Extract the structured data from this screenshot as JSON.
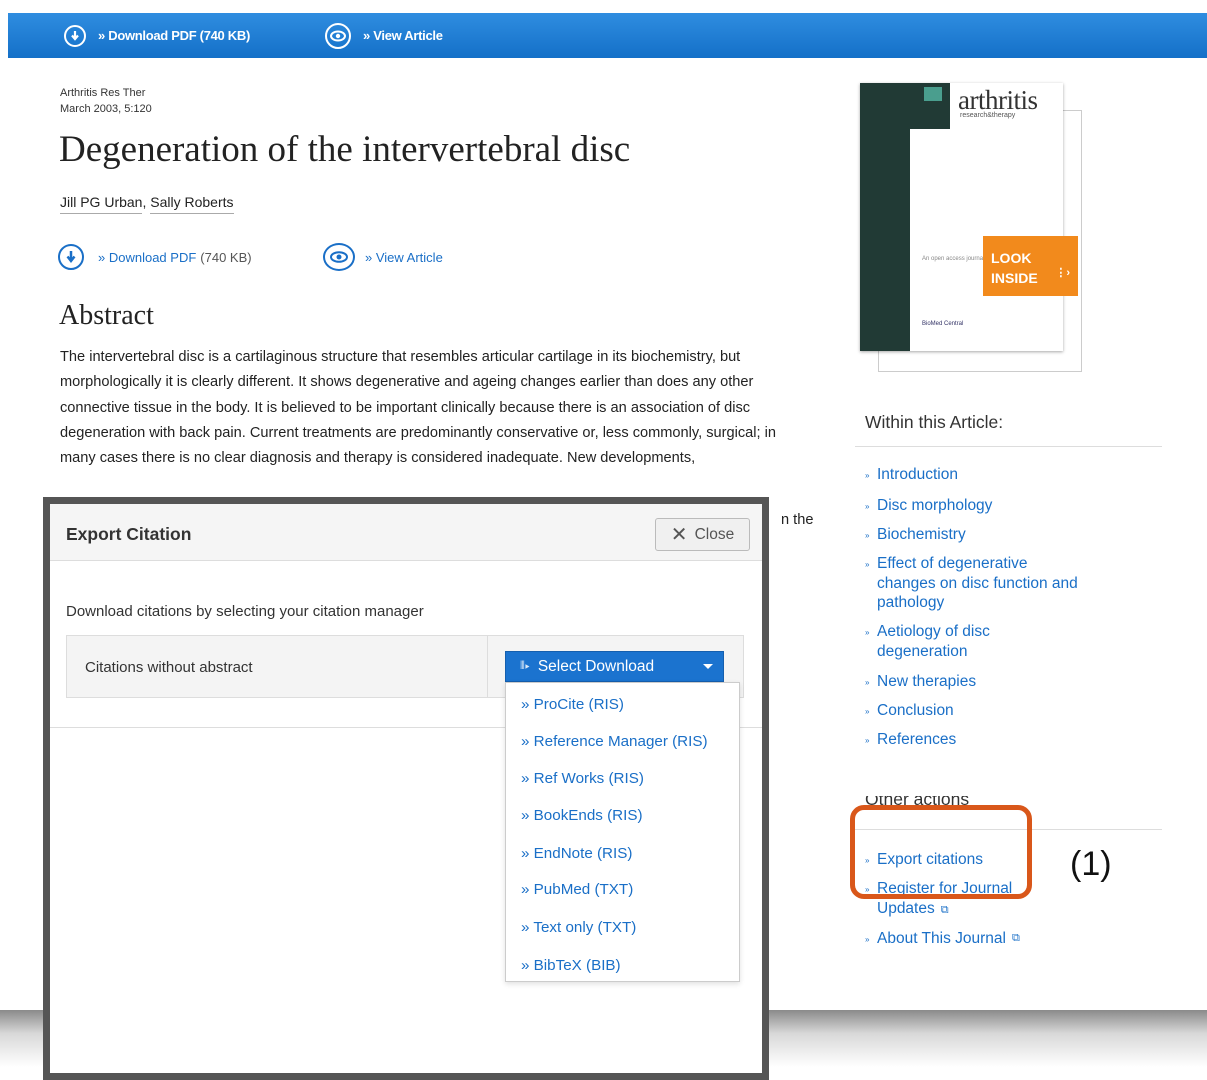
{
  "toolbar": {
    "download_pdf": "» Download PDF (740 KB)",
    "view_article": "» View Article"
  },
  "article": {
    "journal": "Arthritis Res Ther",
    "date_volume": "March 2003, 5:120",
    "title": "Degeneration of the intervertebral disc",
    "authors": [
      "Jill PG Urban",
      "Sally Roberts"
    ],
    "download_pdf": "» Download PDF",
    "download_size": "(740 KB)",
    "view_article": "» View Article",
    "abstract_heading": "Abstract",
    "abstract_text": "The intervertebral disc is a cartilaginous structure that resembles articular cartilage in its biochemistry, but morphologically it is clearly different. It shows degenerative and ageing changes earlier than does any other connective tissue in the body. It is believed to be important clinically because there is an association of disc degeneration with back pain. Current treatments are predominantly conservative or, less commonly, surgical; in many cases there is no clear diagnosis and therapy is considered inadequate. New developments,",
    "abstract_fragment": "n the"
  },
  "cover": {
    "journal_name": "arthritis",
    "journal_sub": "research&therapy",
    "look_inside": "LOOK INSIDE",
    "cover_caption": "An open access journal",
    "publisher_logo": "BioMed Central"
  },
  "within_article": {
    "heading": "Within this Article:",
    "items": [
      "Introduction",
      "Disc morphology",
      "Biochemistry",
      "Effect of degenerative changes on disc function and pathology",
      "Aetiology of disc degeneration",
      "New therapies",
      "Conclusion",
      "References"
    ]
  },
  "other_actions": {
    "heading": "Other actions",
    "items": [
      "Export citations",
      "Register for Journal Updates",
      "About This Journal"
    ]
  },
  "annotation": "(1)",
  "modal": {
    "title": "Export Citation",
    "close_label": "Close",
    "description": "Download citations by selecting your citation manager",
    "row_label": "Citations without abstract",
    "select_label": "Select Download",
    "options": [
      "» ProCite (RIS)",
      "» Reference Manager (RIS)",
      "» Ref Works (RIS)",
      "» BookEnds (RIS)",
      "» EndNote (RIS)",
      "» PubMed (TXT)",
      "» Text only (TXT)",
      "» BibTeX (BIB)"
    ]
  },
  "colors": {
    "toolbar": "#1a7bd6",
    "link": "#1a6fc7",
    "highlight": "#d9571a",
    "look_inside": "#f28a1c",
    "select_button": "#1b73cf"
  }
}
